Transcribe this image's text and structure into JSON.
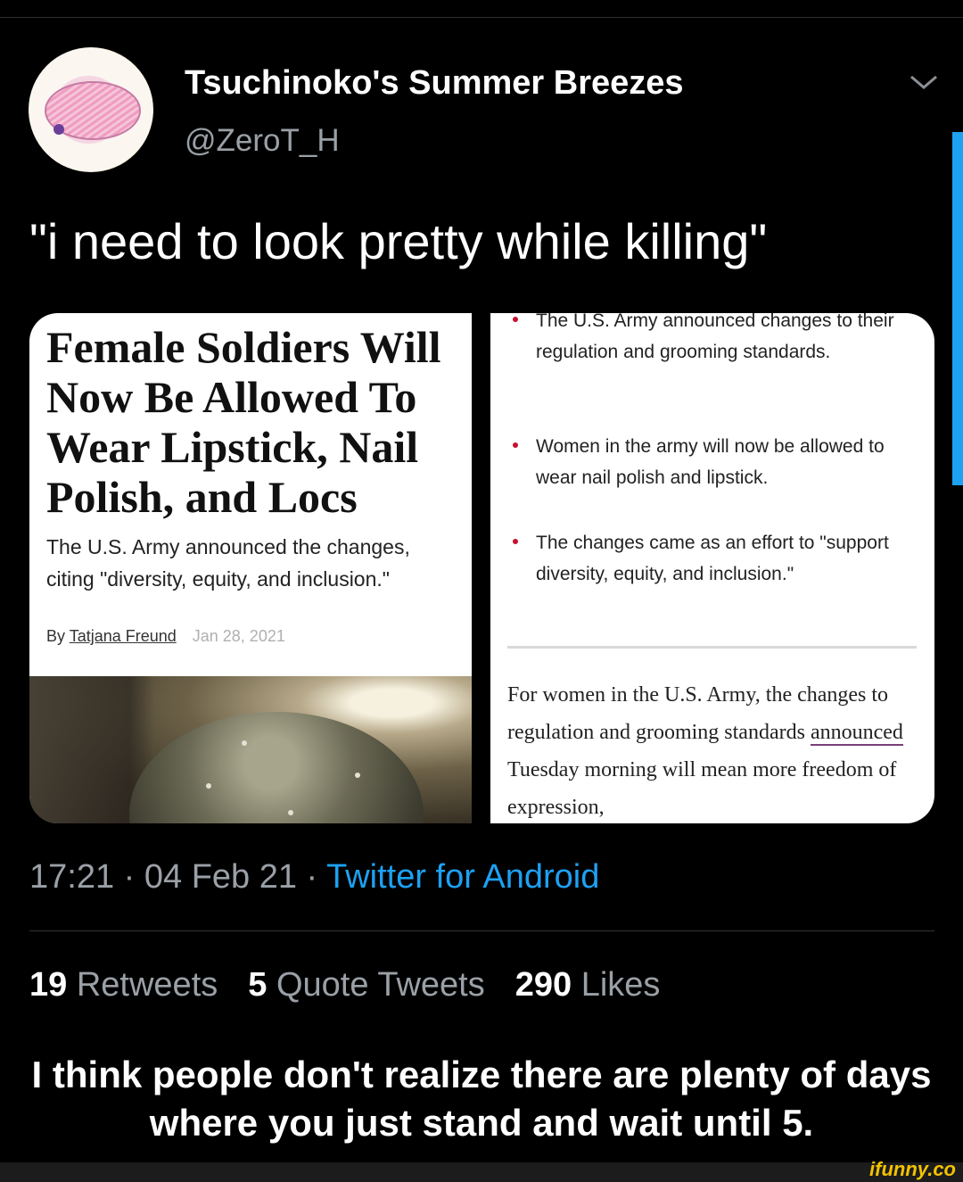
{
  "tweet": {
    "author_name": "Tsuchinoko's Summer Breezes",
    "author_handle": "@ZeroT_H",
    "text": "\"i need to look pretty while killing\"",
    "timestamp": "17:21 · 04 Feb 21 · ",
    "source": "Twitter for Android"
  },
  "article_left": {
    "headline": "Female Soldiers Will Now Be Allowed To Wear Lipstick, Nail Polish, and Locs",
    "subhead": "The U.S. Army announced the changes, citing \"diversity, equity, and inclusion.\"",
    "by_label": "By ",
    "author": "Tatjana Freund",
    "date": "Jan 28, 2021"
  },
  "article_right": {
    "bullets": [
      "The U.S. Army announced changes to their regulation and grooming standards.",
      "Women in the army will now be allowed to wear nail polish and lipstick.",
      "The changes came as an effort to \"support diversity, equity, and inclusion.\""
    ],
    "body_before": "For women in the U.S. Army, the changes to regulation and grooming standards ",
    "body_link": "announced",
    "body_after": " Tuesday morning will mean more freedom of expression,"
  },
  "stats": {
    "retweets_count": "19",
    "retweets_label": "Retweets",
    "quotes_count": "5",
    "quotes_label": "Quote Tweets",
    "likes_count": "290",
    "likes_label": "Likes"
  },
  "caption": "I think people don't realize there are plenty of days where you just stand and wait until 5.",
  "watermark": "ifunny.co",
  "colors": {
    "accent_blue": "#1da1f2",
    "muted_gray": "#9aa0a6",
    "bullet_red": "#c8102e",
    "watermark_yellow": "#f2c200"
  },
  "icons": [
    "avatar-image",
    "chevron-down-icon"
  ]
}
